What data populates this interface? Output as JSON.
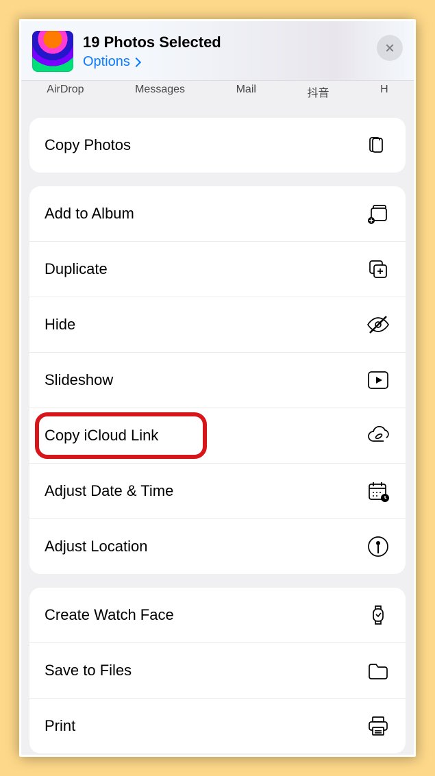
{
  "header": {
    "title": "19 Photos Selected",
    "options": "Options"
  },
  "share_targets": [
    "AirDrop",
    "Messages",
    "Mail",
    "抖音",
    "H"
  ],
  "groups": [
    {
      "rows": [
        {
          "id": "copy-photos",
          "label": "Copy Photos",
          "icon": "copy-docs"
        }
      ]
    },
    {
      "rows": [
        {
          "id": "add-to-album",
          "label": "Add to Album",
          "icon": "album-add"
        },
        {
          "id": "duplicate",
          "label": "Duplicate",
          "icon": "duplicate"
        },
        {
          "id": "hide",
          "label": "Hide",
          "icon": "eye-slash"
        },
        {
          "id": "slideshow",
          "label": "Slideshow",
          "icon": "play"
        },
        {
          "id": "copy-icloud-link",
          "label": "Copy iCloud Link",
          "icon": "cloud-link",
          "highlighted": true
        },
        {
          "id": "adjust-date-time",
          "label": "Adjust Date & Time",
          "icon": "calendar-clock"
        },
        {
          "id": "adjust-location",
          "label": "Adjust Location",
          "icon": "pin-circle"
        }
      ]
    },
    {
      "rows": [
        {
          "id": "create-watch-face",
          "label": "Create Watch Face",
          "icon": "watch"
        },
        {
          "id": "save-to-files",
          "label": "Save to Files",
          "icon": "folder"
        },
        {
          "id": "print",
          "label": "Print",
          "icon": "printer"
        }
      ]
    }
  ]
}
